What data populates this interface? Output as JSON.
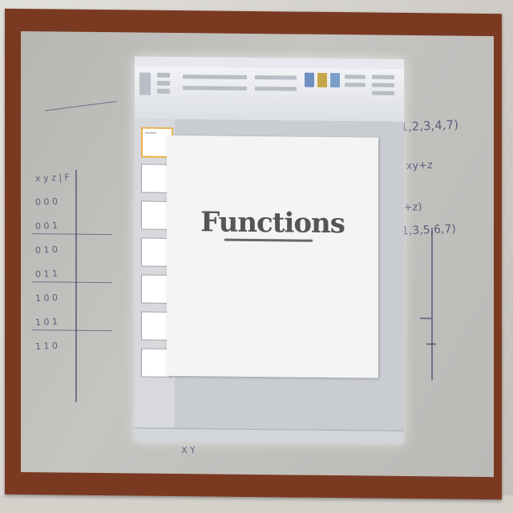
{
  "slide": {
    "title": "Functions"
  },
  "thumbnails": [
    {
      "title": "Functions",
      "selected": true
    },
    {
      "title": "",
      "selected": false
    },
    {
      "title": "",
      "selected": false
    },
    {
      "title": "",
      "selected": false
    },
    {
      "title": "",
      "selected": false
    },
    {
      "title": "",
      "selected": false
    },
    {
      "title": "",
      "selected": false
    }
  ],
  "colors": {
    "frame": "#7a3a22",
    "board": "#c0bebb",
    "marker": "#3b3e66",
    "slide_bg": "#f4f4f2",
    "title_text": "#555555"
  }
}
